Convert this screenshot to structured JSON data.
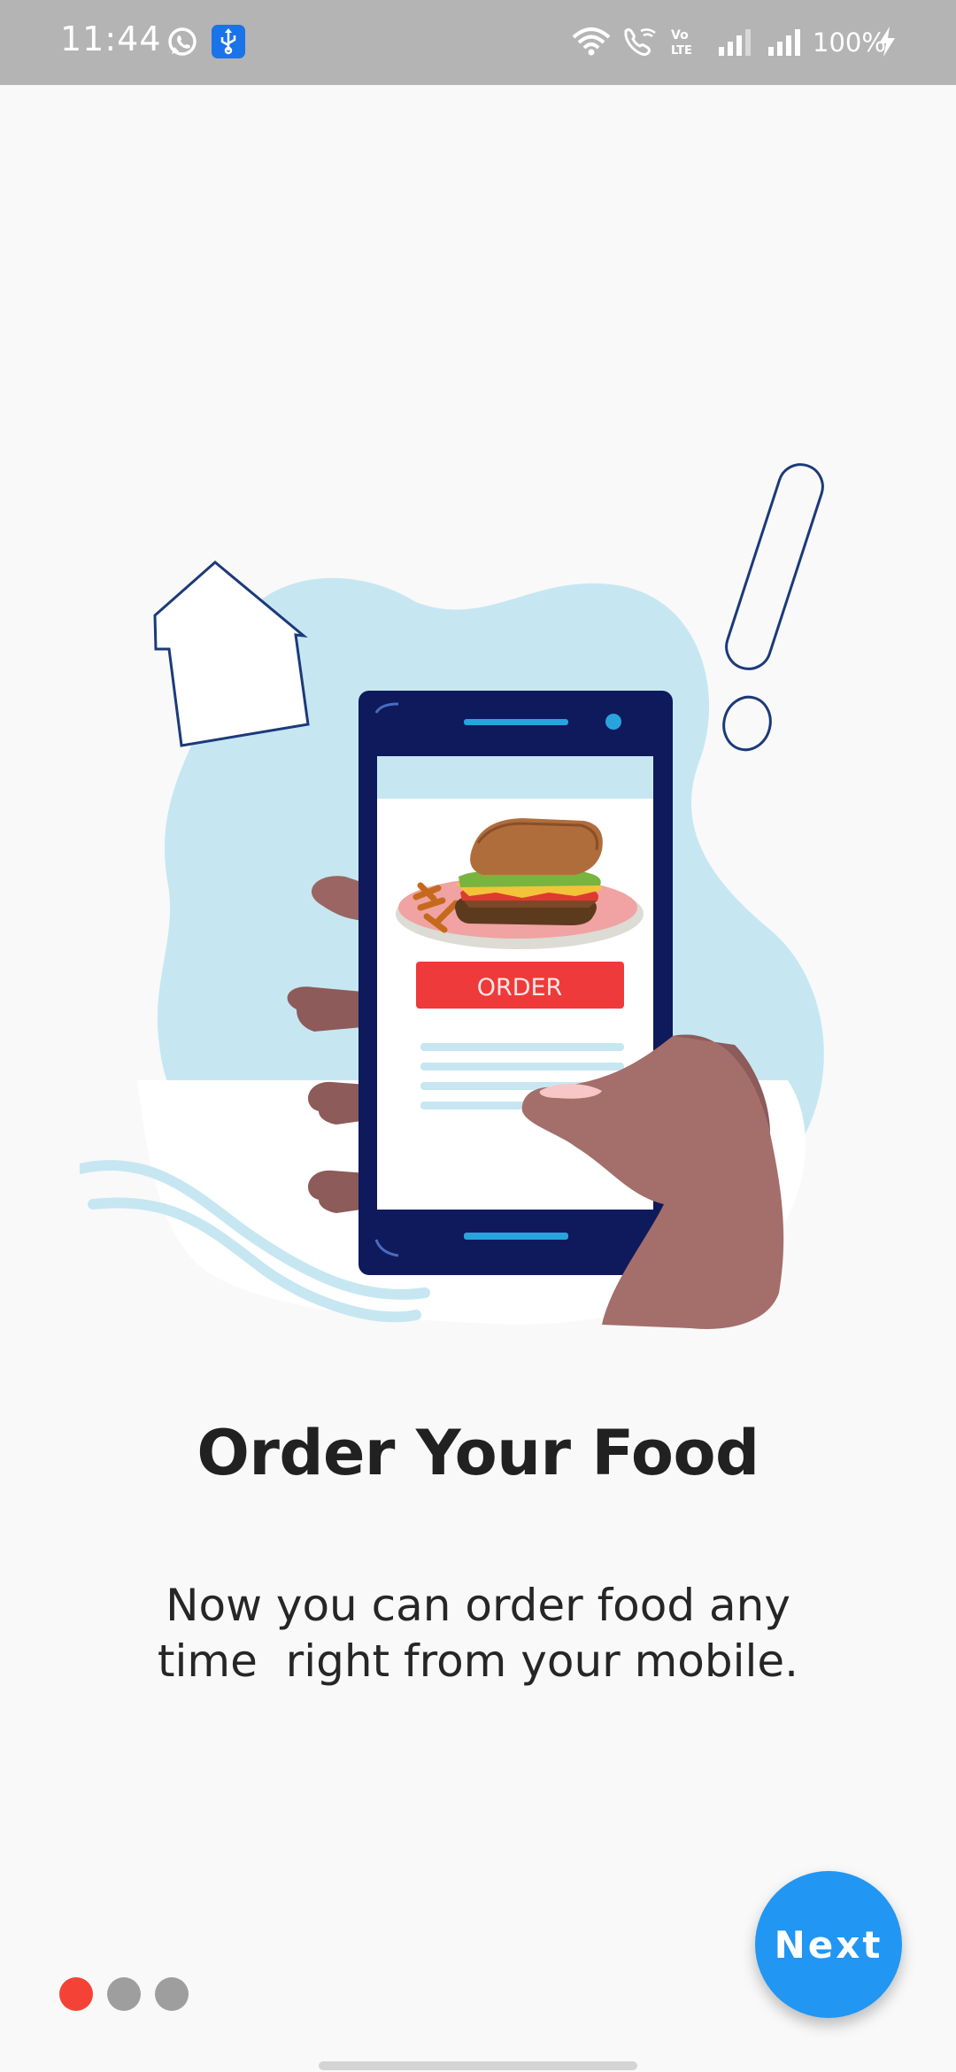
{
  "status_bar": {
    "time": "11:44",
    "battery_percent": "100%",
    "icons": [
      "whatsapp-icon",
      "usb-icon",
      "wifi-icon",
      "wifi-calling-icon",
      "volte-icon",
      "signal-icon",
      "signal-icon",
      "charging-icon"
    ]
  },
  "illustration": {
    "order_button_label": "ORDER"
  },
  "onboarding": {
    "title": "Order Your Food",
    "description_line1": "Now you can order food any",
    "description_line2": "time  right from your mobile.",
    "page_count": 3,
    "current_page": 1,
    "next_label": "Next"
  },
  "colors": {
    "accent": "#2196f3",
    "active_dot": "#f44336",
    "inactive_dot": "#9e9e9e",
    "status_bar": "#b4b4b4"
  }
}
